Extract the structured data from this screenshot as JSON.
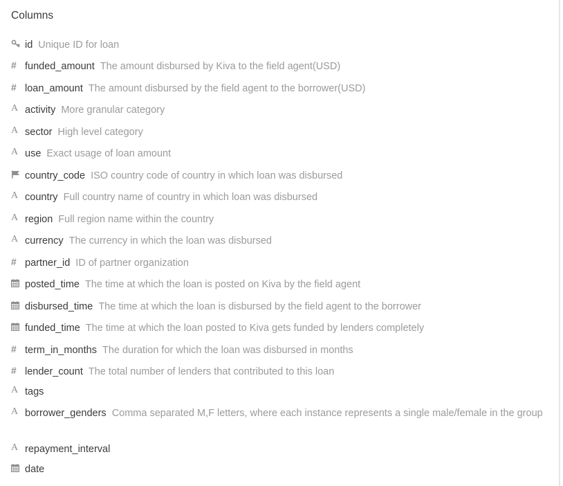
{
  "panel": {
    "title": "Columns"
  },
  "columns": [
    {
      "icon": "key-icon",
      "name": "id",
      "description": "Unique ID for loan"
    },
    {
      "icon": "hash-icon",
      "name": "funded_amount",
      "description": "The amount disbursed by Kiva to the field agent(USD)"
    },
    {
      "icon": "hash-icon",
      "name": "loan_amount",
      "description": "The amount disbursed by the field agent to the borrower(USD)"
    },
    {
      "icon": "text-type-icon",
      "name": "activity",
      "description": "More granular category"
    },
    {
      "icon": "text-type-icon",
      "name": "sector",
      "description": "High level category"
    },
    {
      "icon": "text-type-icon",
      "name": "use",
      "description": "Exact usage of loan amount"
    },
    {
      "icon": "flag-icon",
      "name": "country_code",
      "description": "ISO country code of country in which loan was disbursed"
    },
    {
      "icon": "text-type-icon",
      "name": "country",
      "description": "Full country name of country in which loan was disbursed"
    },
    {
      "icon": "text-type-icon",
      "name": "region",
      "description": "Full region name within the country"
    },
    {
      "icon": "text-type-icon",
      "name": "currency",
      "description": "The currency in which the loan was disbursed"
    },
    {
      "icon": "hash-icon",
      "name": "partner_id",
      "description": "ID of partner organization"
    },
    {
      "icon": "calendar-icon",
      "name": "posted_time",
      "description": "The time at which the loan is posted on Kiva by the field agent"
    },
    {
      "icon": "calendar-icon",
      "name": "disbursed_time",
      "description": "The time at which the loan is disbursed by the field agent to the borrower"
    },
    {
      "icon": "calendar-icon",
      "name": "funded_time",
      "description": "The time at which the loan posted to Kiva gets funded by lenders completely"
    },
    {
      "icon": "hash-icon",
      "name": "term_in_months",
      "description": "The duration for which the loan was disbursed in months"
    },
    {
      "icon": "hash-icon",
      "name": "lender_count",
      "description": "The total number of lenders that contributed to this loan"
    },
    {
      "icon": "text-type-icon",
      "name": "tags",
      "description": ""
    },
    {
      "icon": "text-type-icon",
      "name": "borrower_genders",
      "description": "Comma separated M,F letters, where each instance represents a single male/female in the group"
    },
    {
      "icon": "text-type-icon",
      "name": "repayment_interval",
      "description": ""
    },
    {
      "icon": "calendar-icon",
      "name": "date",
      "description": ""
    }
  ]
}
